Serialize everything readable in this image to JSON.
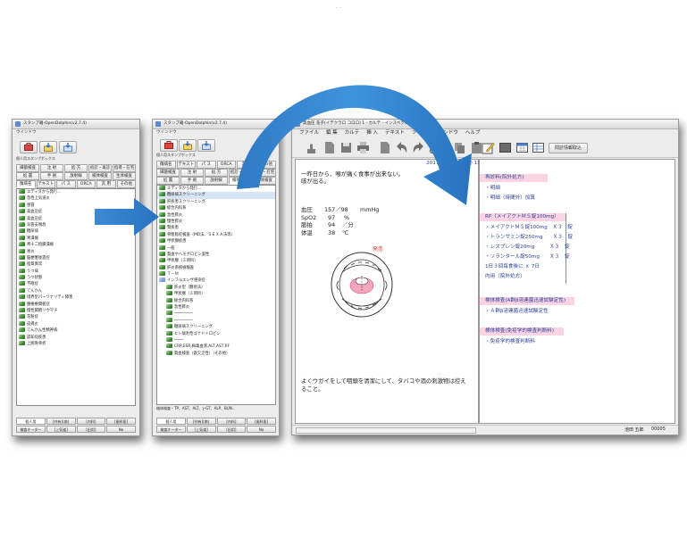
{
  "top_marks": ". .",
  "colors": {
    "arrow_blue": "#2f80c8",
    "accent_text": "#2a3f9a",
    "highlight_pink": "#fbd4e4",
    "red_label": "#e0403c"
  },
  "win1": {
    "title": "スタンプ箱-OpenDolphin(v2.7.4)",
    "menu": "ウインドウ",
    "panel_label": "個人用スタンプボックス",
    "tabs_row1": [
      "細菌検査",
      "注 射",
      "処 方",
      "初診・再診",
      "指導・在宅"
    ],
    "tabs_row2": [
      "処 置",
      "手 術",
      "放射線",
      "検体検査",
      "生体検査"
    ],
    "tabs_row3": [
      "傷病名",
      "テキスト",
      "パ ス",
      "ORCA",
      "汎 用",
      "その他"
    ],
    "items": [
      "エディタから発行...",
      "急性上気道炎",
      "感冒",
      "高血圧症",
      "高血圧症",
      "気管支喘息",
      "糖尿病",
      "胃潰瘍",
      "胃十二指腸潰瘍",
      "胃炎",
      "脳梗塞後遺症",
      "脂質異常",
      "うつ病",
      "うつ状態",
      "不眠症",
      "てんかん",
      "境界型パーソナリティ障害",
      "腰椎椎間板症",
      "慢性関節リウマチ",
      "花粉症",
      "皮膚炎",
      "てんかん性精神病",
      "認知症疾患",
      "上腕骨骨折"
    ],
    "bottom_tabs": [
      "個人用",
      "[共有](病)",
      "[内科]",
      "[歯科医]"
    ],
    "footer": [
      "検査オーダー",
      "[上気道]",
      "[旧用]",
      "No"
    ]
  },
  "win2": {
    "title": "スタンプ箱-OpenDolphin(v2.7.4)",
    "menu": "ウインドウ",
    "panel_label": "個人用スタンプボックス",
    "tabs_row1": [
      "傷病名",
      "テキスト",
      "パ ス",
      "ORCA",
      "汎 用",
      "その他"
    ],
    "tabs_row2": [
      "細菌検査",
      "注 射",
      "処 方",
      "初診・再診",
      "指導・在宅"
    ],
    "tabs_row3": [
      "処 置",
      "手 術",
      "放射線",
      "検体検査",
      "生体検査"
    ],
    "items": [
      {
        "label": "エディタから発行...",
        "type": "plain"
      },
      {
        "label": "糖尿病スクリーニング",
        "type": "selected"
      },
      {
        "label": "肝疾患スクリーニング",
        "type": "plain"
      },
      {
        "label": "総合内科系",
        "type": "plain"
      },
      {
        "label": "急性膵炎",
        "type": "plain"
      },
      {
        "label": "慢性膵炎",
        "type": "plain"
      },
      {
        "label": "腎疾患",
        "type": "plain"
      },
      {
        "label": "骨粗鬆症検査（MD法、ＳＥＸＡ法等）",
        "type": "plain"
      },
      {
        "label": "甲状腺疾患",
        "type": "plain"
      },
      {
        "label": "一般",
        "type": "plain"
      },
      {
        "label": "貧血やヘモグロビン変性",
        "type": "plain"
      },
      {
        "label": "甲状腺（３項目）",
        "type": "plain"
      },
      {
        "label": "肝炎系統檢験査",
        "type": "plain"
      },
      {
        "label": "Ｔ－Ｍ",
        "type": "plain"
      },
      {
        "label": "インフルエンザ感染症",
        "type": "folder"
      },
      {
        "label": "肝炎型（簡易法）",
        "type": "sub"
      },
      {
        "label": "甲状腺（３項目）",
        "type": "sub"
      },
      {
        "label": "総合内科系",
        "type": "sub"
      },
      {
        "label": "急性膵炎",
        "type": "sub"
      },
      {
        "label": "────────",
        "type": "sub"
      },
      {
        "label": "────────",
        "type": "sub"
      },
      {
        "label": "糖尿病スクリーニング",
        "type": "sub"
      },
      {
        "label": "ヒト絨毛性ゴナドトロピン",
        "type": "sub"
      },
      {
        "label": "────",
        "type": "sub"
      },
      {
        "label": "CRP,ESR,梅毒血清,ALT,AST,RF",
        "type": "sub"
      },
      {
        "label": "貧血検査（鉄欠乏性）（その他）",
        "type": "sub"
      }
    ],
    "info_line": "検体検査・TP、AST、ALT、γ-GT、ALP、BUN…",
    "bottom_tabs": [
      "個人用",
      "[共有](病)",
      "[内科]",
      "[歯科医]"
    ],
    "footer": [
      "検査オーダー",
      "[上気道]",
      "[旧用]",
      "No"
    ]
  },
  "main": {
    "title": "高血圧 花子(イデクラロ コロロ) 1 - カルテ - インスペクタ",
    "menu": [
      "ファイル",
      "編 集",
      "カルテ",
      "挿 入",
      "テキスト",
      "ツール",
      "ウインドウ",
      "ヘルプ"
    ],
    "toolbar_right_label": "問診情報取込",
    "date_header": "2017年5月10日(水) 11時38分 (00(国保))",
    "soap": {
      "line1": "一昨日から、喉が痛く食事が出来ない。",
      "line2": "咳が出る。",
      "vitals": [
        {
          "k": "血圧",
          "v": "157／98",
          "u": "mmHg"
        },
        {
          "k": "SpO2",
          "v": "97",
          "u": "%"
        },
        {
          "k": "脈拍",
          "v": "94",
          "u": "／分"
        },
        {
          "k": "体温",
          "v": "38",
          "u": "℃"
        }
      ],
      "diagram_label": "発赤",
      "advice1": "よくウガイをして咽頭を清潔にして、タバコや酒の刺激物は控え",
      "advice2": "ること。"
    },
    "orders": {
      "block1_title": "再診料(院外処方)",
      "block1_lines": [
        "・明細",
        "・明細（時間外）加算"
      ],
      "block2_title": "RP（メイアクトＭＳ錠100mg）",
      "block2_lines": [
        "・メイアクトＭＳ錠100mg　Ｘ３　錠",
        "・トランサミン錠250mg　　Ｘ３　錠",
        "・レスプレン錠20mg　　　Ｘ３　錠",
        "・ソランタール錠50mg　　Ｘ３　錠",
        "1日３回毎食後に ｘ 7日",
        "内用（院外処方）"
      ],
      "block3_title": "検体検査(A群β溶連菌迅速試験定性)",
      "block3_lines": [
        "・Ａ群β溶連菌迅速試験定性"
      ],
      "block4_title": "検体検査(免疫学的検査判断料)",
      "block4_lines": [
        "・免疫学的検査判断料"
      ]
    },
    "status_user": "池田 五郎",
    "status_no": "00005"
  }
}
